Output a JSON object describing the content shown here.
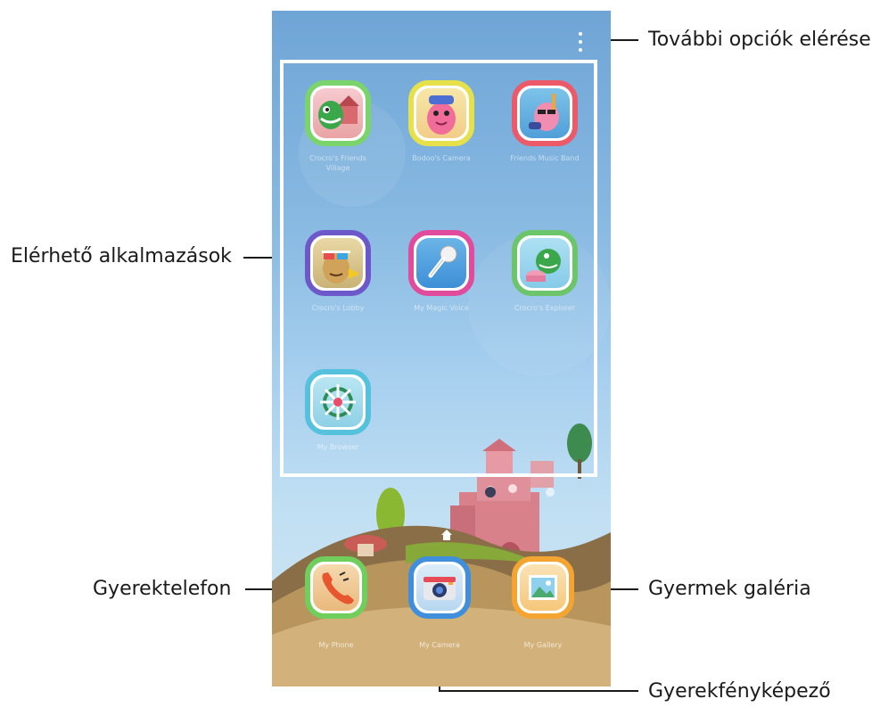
{
  "callouts": {
    "more_options": "További opciók elérése",
    "available_apps": "Elérhető alkalmazások",
    "kids_phone": "Gyerektelefon",
    "kids_gallery": "Gyermek galéria",
    "kids_camera": "Gyerekfényképező"
  },
  "apps": [
    {
      "label": "Crocro's Friends Village",
      "icon": "dino-house-icon"
    },
    {
      "label": "Bodoo's Camera",
      "icon": "pink-creature-icon"
    },
    {
      "label": "Friends Music Band",
      "icon": "flamingo-guitar-icon"
    },
    {
      "label": "Crocro's Lobby",
      "icon": "3d-glasses-creature-icon"
    },
    {
      "label": "My Magic Voice",
      "icon": "microphone-icon"
    },
    {
      "label": "Crocro's Explorer",
      "icon": "dino-drum-icon"
    },
    {
      "label": "My Browser",
      "icon": "ship-wheel-icon"
    }
  ],
  "dock": [
    {
      "label": "My Phone",
      "icon": "phone-icon"
    },
    {
      "label": "My Camera",
      "icon": "camera-icon"
    },
    {
      "label": "My Gallery",
      "icon": "gallery-icon"
    }
  ],
  "colors": {
    "sky_top": "#6fa5d6",
    "sky_bottom": "#cfe5f1",
    "frame": "#ffffff",
    "phone_tile": "#7bd46b",
    "camera_tile": "#3f8fdc",
    "gallery_tile": "#f4a531"
  }
}
